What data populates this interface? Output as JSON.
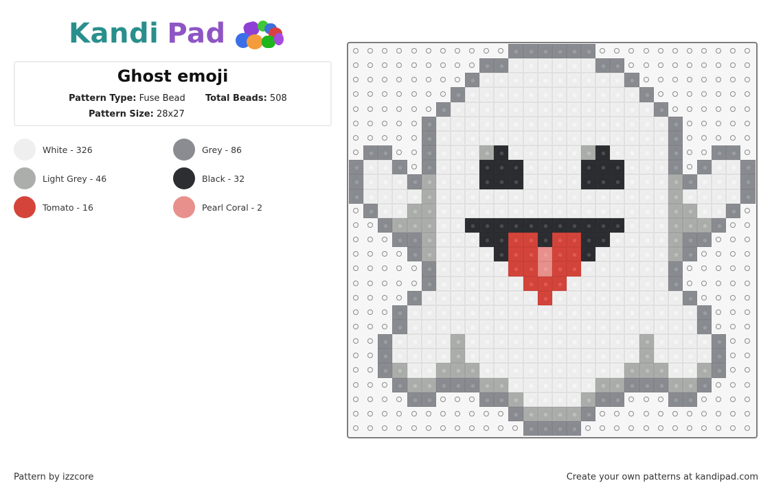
{
  "logo": {
    "part1": "Kandi",
    "part2": "Pad"
  },
  "pattern": {
    "title": "Ghost emoji",
    "type_label": "Pattern Type:",
    "type_value": "Fuse Bead",
    "beads_label": "Total Beads:",
    "beads_value": "508",
    "size_label": "Pattern Size:",
    "size_value": "28x27"
  },
  "palette": [
    {
      "key": "W",
      "name": "White - 326",
      "color": "#efefef",
      "ring": "#e8e8e8",
      "hole": "#f3f3f3"
    },
    {
      "key": "G",
      "name": "Grey - 86",
      "color": "#8a8c91",
      "ring": "#878a8f",
      "hole": "#9b9da1"
    },
    {
      "key": "L",
      "name": "Light Grey - 46",
      "color": "#abaeab",
      "ring": "#a9aca9",
      "hole": "#bcbfbc"
    },
    {
      "key": "B",
      "name": "Black - 32",
      "color": "#2d2e32",
      "ring": "#2b2c30",
      "hole": "#4a4b4f"
    },
    {
      "key": "R",
      "name": "Tomato - 16",
      "color": "#d4443a",
      "ring": "#d2433a",
      "hole": "#df5a51"
    },
    {
      "key": "P",
      "name": "Pearl Coral - 2",
      "color": "#e8908c",
      "ring": "#e8908c",
      "hole": "#ec9e9a"
    }
  ],
  "grid": {
    "columns": 28,
    "rows": 27,
    "legend": "W=White G=Grey L=Light Grey B=Black R=Tomato P=Pearl Coral .=empty",
    "data": [
      "...........GGGGGG...........",
      ".........GGWWWWWWGG.........",
      "........GWWWWWWWWWWG........",
      ".......GWWWWWWWWWWWWG.......",
      "......GWWWWWWWWWWWWWWG......",
      ".....GWWWWWWWWWWWWWWWWG.....",
      ".....GWWWWWWWWWWWWWWWWG.....",
      ".GG..GWWWLBWWWWWLBWWWWG..GG.",
      "GWWG.GWWWBBBWWWWBBBWWWG.GWWG",
      "GWWWGLWWWBBBWWWWBBBWWWLGWWWG",
      "GWWWWLWWWWWWWWWWWWWWWWLWWWWG",
      ".GWWLLWWWWWWWWWWWWWWWWLLWWG.",
      "..GLLLWWBBBBBBBBBBBWWWLLLG..",
      "...GGLWWWBBRRBRRBBWWWWLGG...",
      "....GLWWWWBRRPRRBWWWWWLG....",
      ".....GWWWWWRRPRRWWWWWWG.....",
      ".....GWWWWWWRRRWWWWWWWG.....",
      "....GWWWWWWWWRWWWWWWWWWG....",
      "...GWWWWWWWWWWWWWWWWWWWWG...",
      "...GWWWWWWWWWWWWWWWWWWWWG...",
      "..GWWWWLWWWWWWWWWWWWLWWWWG..",
      "..GWWWWLWWWWWWWWWWWWLWWWWG..",
      "..GLWWLLLWWWWWWWWWWLLLWWLG..",
      "...GLLGGGLLWWWWWWLLGGGLLG...",
      "....GG...GGLWWWWLGG...GG....",
      "...........GLLLLG...........",
      "............GGGG............"
    ]
  },
  "footer": {
    "left": "Pattern by izzcore",
    "right": "Create your own patterns at kandipad.com"
  }
}
